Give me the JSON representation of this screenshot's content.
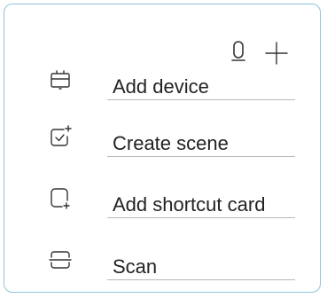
{
  "header": {
    "icons": [
      "microphone-icon",
      "plus-icon"
    ]
  },
  "menu": {
    "items": [
      {
        "label": "Add device",
        "icon": "device-icon"
      },
      {
        "label": "Create scene",
        "icon": "scene-check-icon"
      },
      {
        "label": "Add shortcut card",
        "icon": "shortcut-card-icon"
      },
      {
        "label": "Scan",
        "icon": "scan-icon"
      }
    ]
  },
  "colors": {
    "border": "#8fc3d8",
    "text": "#222222",
    "icon": "#333333",
    "divider": "#b8b8b8"
  }
}
